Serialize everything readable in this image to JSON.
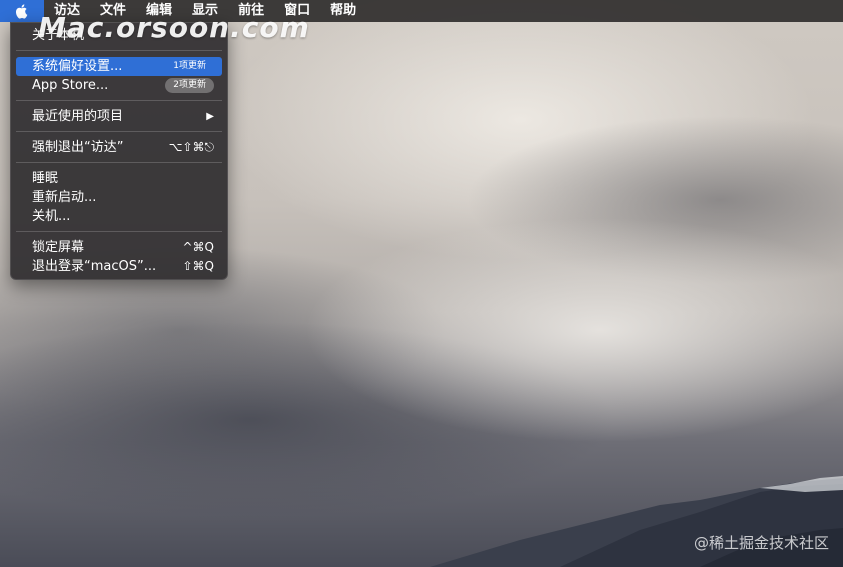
{
  "menubar": {
    "apple_icon": "apple-logo-icon",
    "menus": [
      "访达",
      "文件",
      "编辑",
      "显示",
      "前往",
      "窗口",
      "帮助"
    ]
  },
  "apple_menu": {
    "about": "关于本机",
    "system_prefs": "系统偏好设置...",
    "system_prefs_badge": "1项更新",
    "app_store": "App Store...",
    "app_store_badge": "2项更新",
    "recent_items": "最近使用的项目",
    "force_quit": "强制退出“访达”",
    "force_quit_shortcut": "⌥⇧⌘⎋",
    "sleep": "睡眠",
    "restart": "重新启动...",
    "shutdown": "关机...",
    "lock_screen": "锁定屏幕",
    "lock_screen_shortcut": "^⌘Q",
    "logout": "退出登录“macOS”...",
    "logout_shortcut": "⇧⌘Q"
  },
  "watermarks": {
    "top": "Mac.orsoon.com",
    "bottom": "@稀土掘金技术社区"
  },
  "colors": {
    "highlight": "#2f6fd6",
    "menubar": "#282626",
    "menu_bg": "#302e30"
  }
}
